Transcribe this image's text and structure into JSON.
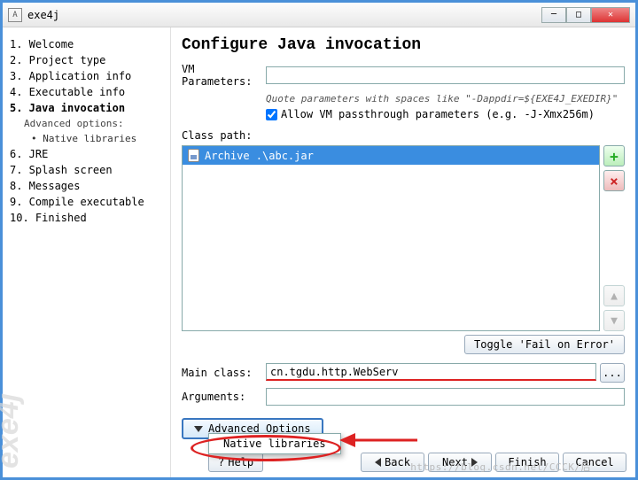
{
  "window": {
    "title": "exe4j",
    "icon_glyph": "A"
  },
  "sidebar": {
    "items": [
      {
        "label": "1. Welcome"
      },
      {
        "label": "2. Project type"
      },
      {
        "label": "3. Application info"
      },
      {
        "label": "4. Executable info"
      },
      {
        "label": "5. Java invocation",
        "selected": true
      },
      {
        "label": "6. JRE"
      },
      {
        "label": "7. Splash screen"
      },
      {
        "label": "8. Messages"
      },
      {
        "label": "9. Compile executable"
      },
      {
        "label": "10. Finished"
      }
    ],
    "advanced_label": "Advanced options:",
    "advanced_items": [
      {
        "label": "• Native libraries"
      }
    ],
    "brand": "exe4j"
  },
  "main": {
    "heading": "Configure Java invocation",
    "vm_params_label": "VM Parameters:",
    "vm_params_value": "",
    "quote_hint": "Quote parameters with spaces like \"-Dappdir=${EXE4J_EXEDIR}\"",
    "allow_passthrough_label": "Allow VM passthrough parameters (e.g. -J-Xmx256m)",
    "allow_passthrough_checked": true,
    "class_path_label": "Class path:",
    "class_path_items": [
      {
        "label": "Archive .\\abc.jar"
      }
    ],
    "toggle_fail_label": "Toggle 'Fail on Error'",
    "main_class_label": "Main class:",
    "main_class_value": "cn.tgdu.http.WebServ",
    "arguments_label": "Arguments:",
    "arguments_value": "",
    "advanced_options_label": "Advanced Options",
    "popup_item": "Native libraries",
    "help_label": "Help"
  },
  "wizard": {
    "back": "Back",
    "next": "Next",
    "finish": "Finish",
    "cancel": "Cancel"
  },
  "watermark": "https://blog.csdn.net/CCCK/后"
}
